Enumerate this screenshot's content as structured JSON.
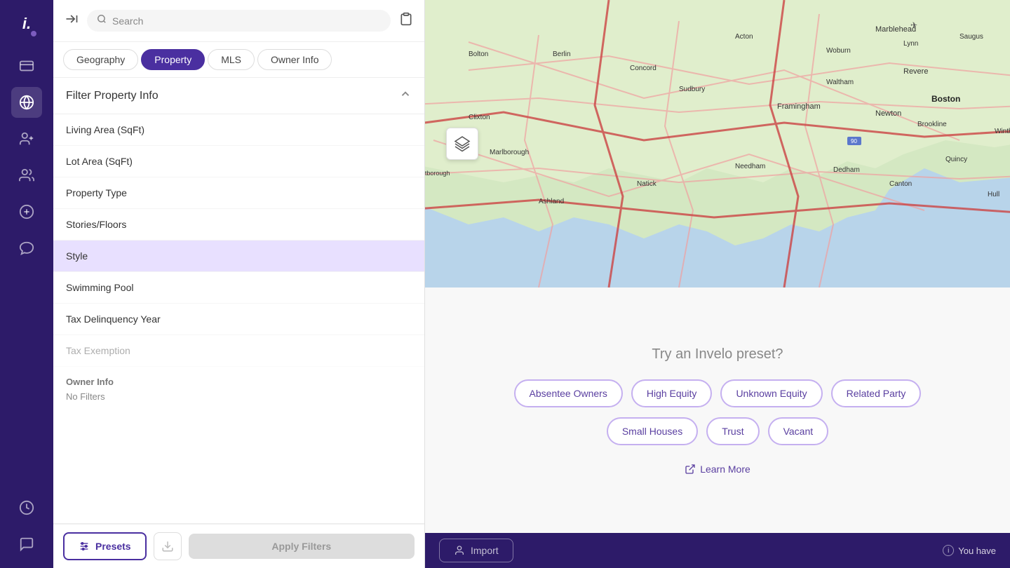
{
  "app": {
    "title": "Invelo"
  },
  "sidebar": {
    "items": [
      {
        "id": "logo",
        "label": "i.",
        "icon": "i"
      },
      {
        "id": "card",
        "label": "Dashboard",
        "icon": "▬"
      },
      {
        "id": "globe",
        "label": "Map",
        "icon": "◉",
        "active": true
      },
      {
        "id": "add-user",
        "label": "Add Contact",
        "icon": "⊕"
      },
      {
        "id": "team",
        "label": "Team",
        "icon": "⊞"
      },
      {
        "id": "money",
        "label": "Finance",
        "icon": "◎"
      },
      {
        "id": "megaphone",
        "label": "Marketing",
        "icon": "📢"
      },
      {
        "id": "history",
        "label": "History",
        "icon": "◷"
      },
      {
        "id": "chat",
        "label": "Chat",
        "icon": "💬"
      }
    ]
  },
  "topbar": {
    "expand_icon": "⊣",
    "search_placeholder": "Search",
    "clipboard_icon": "📋"
  },
  "tabs": {
    "items": [
      {
        "id": "geography",
        "label": "Geography",
        "active": false
      },
      {
        "id": "property",
        "label": "Property",
        "active": true
      },
      {
        "id": "mls",
        "label": "MLS",
        "active": false
      },
      {
        "id": "owner_info",
        "label": "Owner Info",
        "active": false
      }
    ]
  },
  "filter_section": {
    "title": "Filter Property Info",
    "collapse_icon": "∧",
    "items": [
      {
        "id": "living_area",
        "label": "Living Area (SqFt)",
        "selected": false
      },
      {
        "id": "lot_area",
        "label": "Lot Area (SqFt)",
        "selected": false
      },
      {
        "id": "property_type",
        "label": "Property Type",
        "selected": false
      },
      {
        "id": "stories_floors",
        "label": "Stories/Floors",
        "selected": false
      },
      {
        "id": "style",
        "label": "Style",
        "selected": true
      },
      {
        "id": "swimming_pool",
        "label": "Swimming Pool",
        "selected": false
      },
      {
        "id": "tax_delinquency_year",
        "label": "Tax Delinquency Year",
        "selected": false
      },
      {
        "id": "tax_exemption",
        "label": "Tax Exemption",
        "selected": false
      }
    ],
    "owner_info_section_label": "Owner Info",
    "no_filters_label": "No Filters"
  },
  "bottom_toolbar": {
    "presets_label": "Presets",
    "export_icon": "⬇",
    "apply_label": "Apply Filters"
  },
  "preset_panel": {
    "title": "Try an Invelo preset?",
    "chips_row1": [
      {
        "id": "absentee_owners",
        "label": "Absentee Owners"
      },
      {
        "id": "high_equity",
        "label": "High Equity"
      },
      {
        "id": "unknown_equity",
        "label": "Unknown Equity"
      },
      {
        "id": "related_party",
        "label": "Related Party"
      }
    ],
    "chips_row2": [
      {
        "id": "small_houses",
        "label": "Small Houses"
      },
      {
        "id": "trust",
        "label": "Trust"
      },
      {
        "id": "vacant",
        "label": "Vacant"
      }
    ],
    "learn_more_label": "Learn More",
    "learn_more_icon": "↗"
  },
  "status_bar": {
    "import_icon": "👤",
    "import_label": "Import",
    "status_text": "You have",
    "info_icon": "i"
  },
  "map_layers_icon": "≡"
}
